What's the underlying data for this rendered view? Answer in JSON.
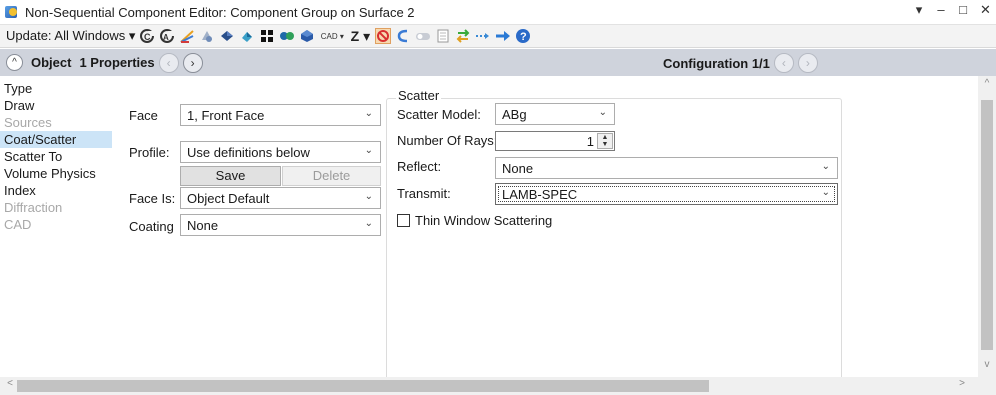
{
  "window": {
    "title": "Non-Sequential Component Editor: Component Group on Surface 2",
    "controls": {
      "menu": "▾",
      "minimize": "–",
      "maximize": "□",
      "close": "✕"
    }
  },
  "toolbar": {
    "update_label": "Update: All Windows ▾",
    "cad_label": "CAD ▾",
    "z_label": "Z ▾",
    "icons": [
      "reload-c-icon",
      "reload-ca-icon",
      "ray-trace-icon",
      "shaded-model-icon",
      "solid-model-icon",
      "object-icon",
      "grid-icon",
      "dots-icon",
      "sphere-icon",
      "cad-icon",
      "z-icon",
      "no-icon",
      "undo-icon",
      "toggle-icon",
      "page-icon",
      "exchange-icon",
      "dots-arrow-icon",
      "arrow-right-icon",
      "help-icon"
    ]
  },
  "header": {
    "object_label": "Object",
    "properties_label": "1 Properties",
    "configuration_label": "Configuration 1/1"
  },
  "nav": {
    "items": [
      {
        "label": "Type",
        "state": "normal"
      },
      {
        "label": "Draw",
        "state": "normal"
      },
      {
        "label": "Sources",
        "state": "disabled"
      },
      {
        "label": "Coat/Scatter",
        "state": "selected"
      },
      {
        "label": "Scatter To",
        "state": "normal"
      },
      {
        "label": "Volume Physics",
        "state": "normal"
      },
      {
        "label": "Index",
        "state": "normal"
      },
      {
        "label": "Diffraction",
        "state": "disabled"
      },
      {
        "label": "CAD",
        "state": "disabled"
      }
    ]
  },
  "form": {
    "face_label": "Face",
    "face_value": "1, Front Face",
    "profile_label": "Profile:",
    "profile_value": "Use definitions below",
    "save_label": "Save",
    "delete_label": "Delete",
    "face_is_label": "Face Is:",
    "face_is_value": "Object Default",
    "coating_label": "Coating",
    "coating_value": "None"
  },
  "scatter": {
    "group_title": "Scatter",
    "model_label": "Scatter Model:",
    "model_value": "ABg",
    "rays_label": "Number Of Rays:",
    "rays_value": "1",
    "reflect_label": "Reflect:",
    "reflect_value": "None",
    "transmit_label": "Transmit:",
    "transmit_value": "LAMB-SPEC",
    "thin_window_label": "Thin Window Scattering",
    "thin_window_checked": false
  },
  "colors": {
    "header_bg": "#cfd3dc",
    "selected_bg": "#cce4f7",
    "disabled_text": "#a8a8a8"
  }
}
